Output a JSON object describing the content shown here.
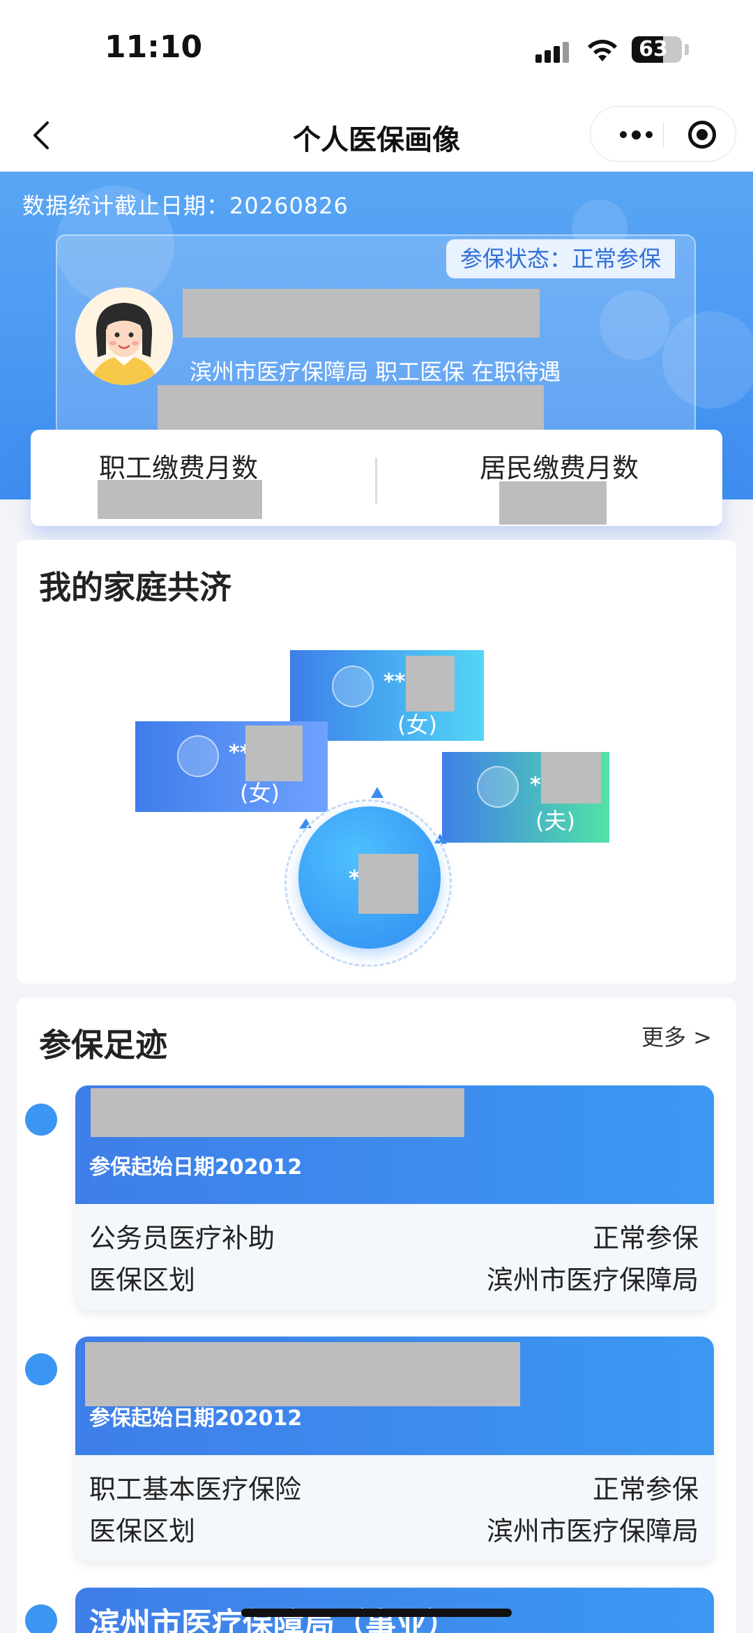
{
  "status_bar": {
    "time": "11:10",
    "battery": "63",
    "battery_level": 0.63
  },
  "nav": {
    "title": "个人医保画像"
  },
  "hero": {
    "stat_date_label": "数据统计截止日期：",
    "stat_date": "20260826",
    "insured_status": "参保状态：正常参保",
    "org_line": "滨州市医疗保障局 职工医保 在职待遇"
  },
  "months": {
    "employee_label": "职工缴费月数",
    "resident_label": "居民缴费月数"
  },
  "family": {
    "title": "我的家庭共济",
    "members": [
      {
        "mask": "**",
        "role": "(女)"
      },
      {
        "mask": "**",
        "role": "(女)"
      },
      {
        "mask": "*",
        "role": "(夫)"
      }
    ],
    "self_mask": "*"
  },
  "footprint": {
    "title": "参保足迹",
    "more": "更多 >",
    "items": [
      {
        "start": "参保起始日期202012",
        "type": "公务员医疗补助",
        "status": "正常参保",
        "region_label": "医保区划",
        "region": "滨州市医疗保障局"
      },
      {
        "start": "参保起始日期202012",
        "type": "职工基本医疗保险",
        "status": "正常参保",
        "region_label": "医保区划",
        "region": "滨州市医疗保障局"
      },
      {
        "title": "滨州市医疗保障局（事业）"
      }
    ]
  },
  "colors": {
    "primary": "#3d8df0",
    "accent_green": "#4de0a4",
    "accent_cyan": "#4fd6f5",
    "dot": "#3b95f2"
  }
}
